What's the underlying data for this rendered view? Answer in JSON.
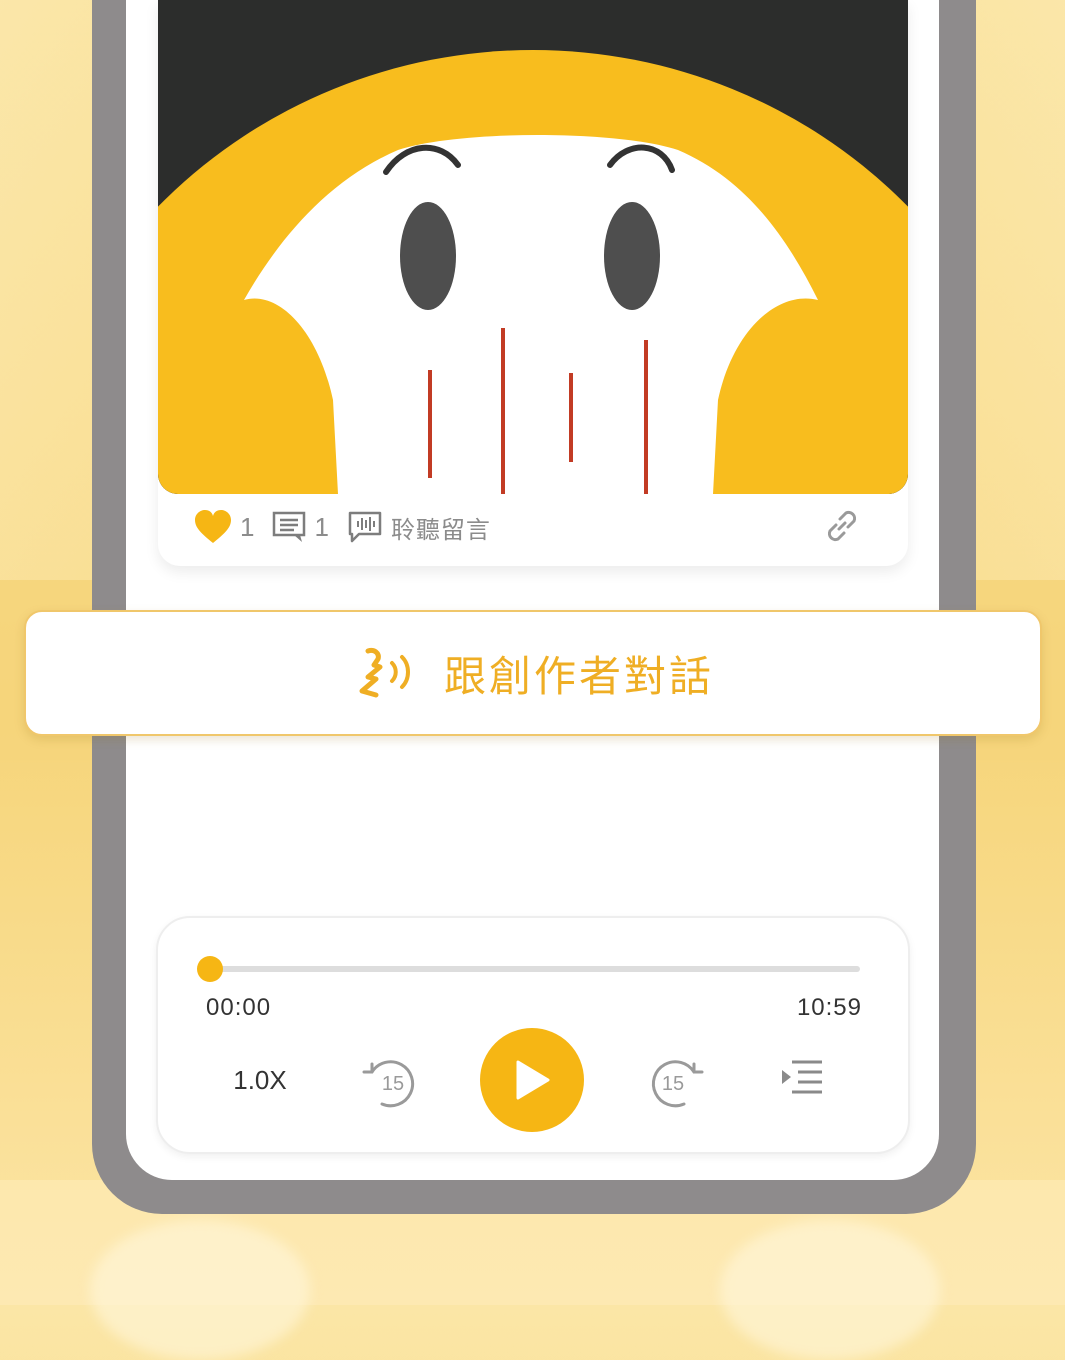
{
  "stats": {
    "likes_count": "1",
    "comments_count": "1",
    "listen_label": "聆聽留言"
  },
  "banner": {
    "label": "跟創作者對話"
  },
  "player": {
    "current_time": "00:00",
    "duration": "10:59",
    "speed_label": "1.0X",
    "rewind_label": "15",
    "forward_label": "15",
    "progress": 0
  },
  "colors": {
    "accent": "#f6b614",
    "banner_text": "#efae24",
    "cover_yellow": "#f8bd1e",
    "cover_dark": "#2c2d2c",
    "phone_frame": "#8e8b8c"
  },
  "icons": {
    "like": "heart-icon",
    "comment": "comment-icon",
    "listen": "voice-message-icon",
    "share": "link-icon",
    "banner": "speaking-head-icon",
    "rewind": "rewind-15-icon",
    "play": "play-icon",
    "forward": "forward-15-icon",
    "playlist": "playlist-icon"
  }
}
